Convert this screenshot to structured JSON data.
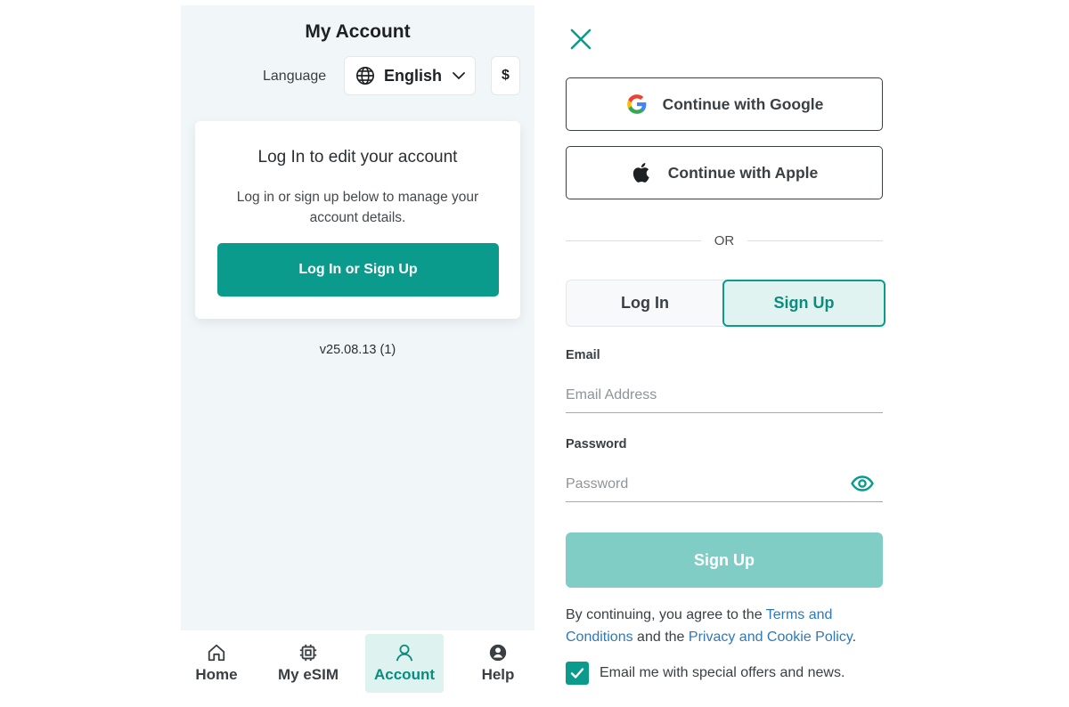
{
  "account_screen": {
    "title": "My Account",
    "language_label": "Language",
    "language_value": "English",
    "currency_symbol": "$",
    "card": {
      "title": "Log In to edit your account",
      "description": "Log in or sign up below to manage your account details.",
      "button_label": "Log In or Sign Up"
    },
    "version": "v25.08.13 (1)",
    "tabs": [
      {
        "label": "Home",
        "icon": "home-icon",
        "active": false
      },
      {
        "label": "My eSIM",
        "icon": "chip-icon",
        "active": false
      },
      {
        "label": "Account",
        "icon": "user-icon",
        "active": true
      },
      {
        "label": "Help",
        "icon": "help-icon",
        "active": false
      }
    ]
  },
  "auth_screen": {
    "google_label": "Continue with Google",
    "apple_label": "Continue with Apple",
    "or_text": "OR",
    "segment": {
      "login": "Log In",
      "signup": "Sign Up",
      "selected": "Sign Up"
    },
    "email_label": "Email",
    "email_placeholder": "Email Address",
    "password_label": "Password",
    "password_placeholder": "Password",
    "submit_label": "Sign Up",
    "terms": {
      "prefix": "By continuing, you agree to the ",
      "terms_link": "Terms and Conditions",
      "middle": " and the ",
      "privacy_link": "Privacy and Cookie Policy",
      "suffix": "."
    },
    "offers_checkbox": {
      "label": "Email me with special offers and news.",
      "checked": true
    }
  },
  "colors": {
    "accent": "#0a9b8c",
    "accent_light": "#e1f3f1",
    "disabled_button": "#7fcdc5",
    "link": "#2e78b8",
    "left_background": "#f1f6f8"
  }
}
